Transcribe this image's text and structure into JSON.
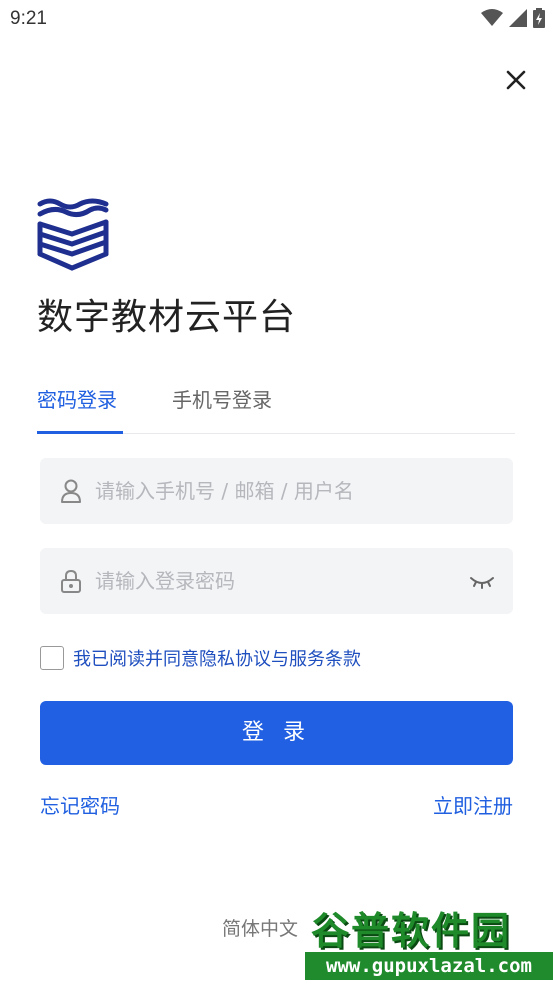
{
  "status_bar": {
    "time": "9:21"
  },
  "app": {
    "title": "数字教材云平台"
  },
  "tabs": [
    {
      "label": "密码登录",
      "active": true
    },
    {
      "label": "手机号登录",
      "active": false
    }
  ],
  "form": {
    "username_placeholder": "请输入手机号 / 邮箱 / 用户名",
    "password_placeholder": "请输入登录密码",
    "agreement_text": "我已阅读并同意隐私协议与服务条款",
    "login_label": "登 录"
  },
  "links": {
    "forgot": "忘记密码",
    "register": "立即注册"
  },
  "footer": {
    "language": "简体中文"
  },
  "watermark": {
    "title": "谷普软件园",
    "url": "www.gupuxlazal.com"
  },
  "colors": {
    "accent": "#2160e2",
    "logo": "#1f2f8f"
  }
}
